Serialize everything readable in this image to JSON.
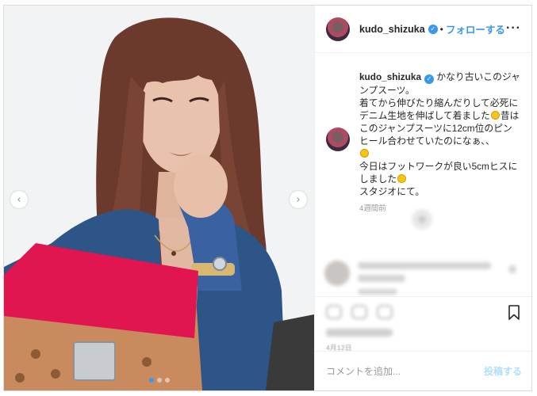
{
  "post": {
    "username": "kudo_shizuka",
    "verified_icon": "verified-badge-icon",
    "separator": "•",
    "follow_label": "フォローする",
    "more_icon": "more-options-icon",
    "more_glyph": "···"
  },
  "photo": {
    "carousel_left_glyph": "‹",
    "carousel_right_glyph": "›",
    "slide_count": 3,
    "active_slide": 1,
    "colors": {
      "background": "#eef0f2",
      "hair": "#6b3a2c",
      "skin": "#e9c2ad",
      "denim": "#2e5587",
      "bag_red": "#e1154f",
      "bag_tan": "#c98a5e"
    }
  },
  "caption": {
    "username": "kudo_shizuka",
    "line1": "かなり古いこのジャンプスーツ。",
    "line2a": "着てから伸びたり縮んだりして必死にデニム生地を伸ばして着ました",
    "line2b": "昔はこのジャンプスーツに12cm位のピンヒール合わせていたのになぁ、、",
    "line3": "今日はフットワークが良い5cmヒスにしました",
    "line4": "スタジオにて。",
    "time": "4週間前"
  },
  "footer": {
    "date": "4月12日",
    "comment_placeholder": "コメントを追加...",
    "post_label": "投稿する",
    "bookmark_icon": "bookmark-icon"
  },
  "colors": {
    "accent": "#3897f0",
    "text": "#262626",
    "muted": "#999999",
    "post_disabled": "#b2dffc"
  }
}
